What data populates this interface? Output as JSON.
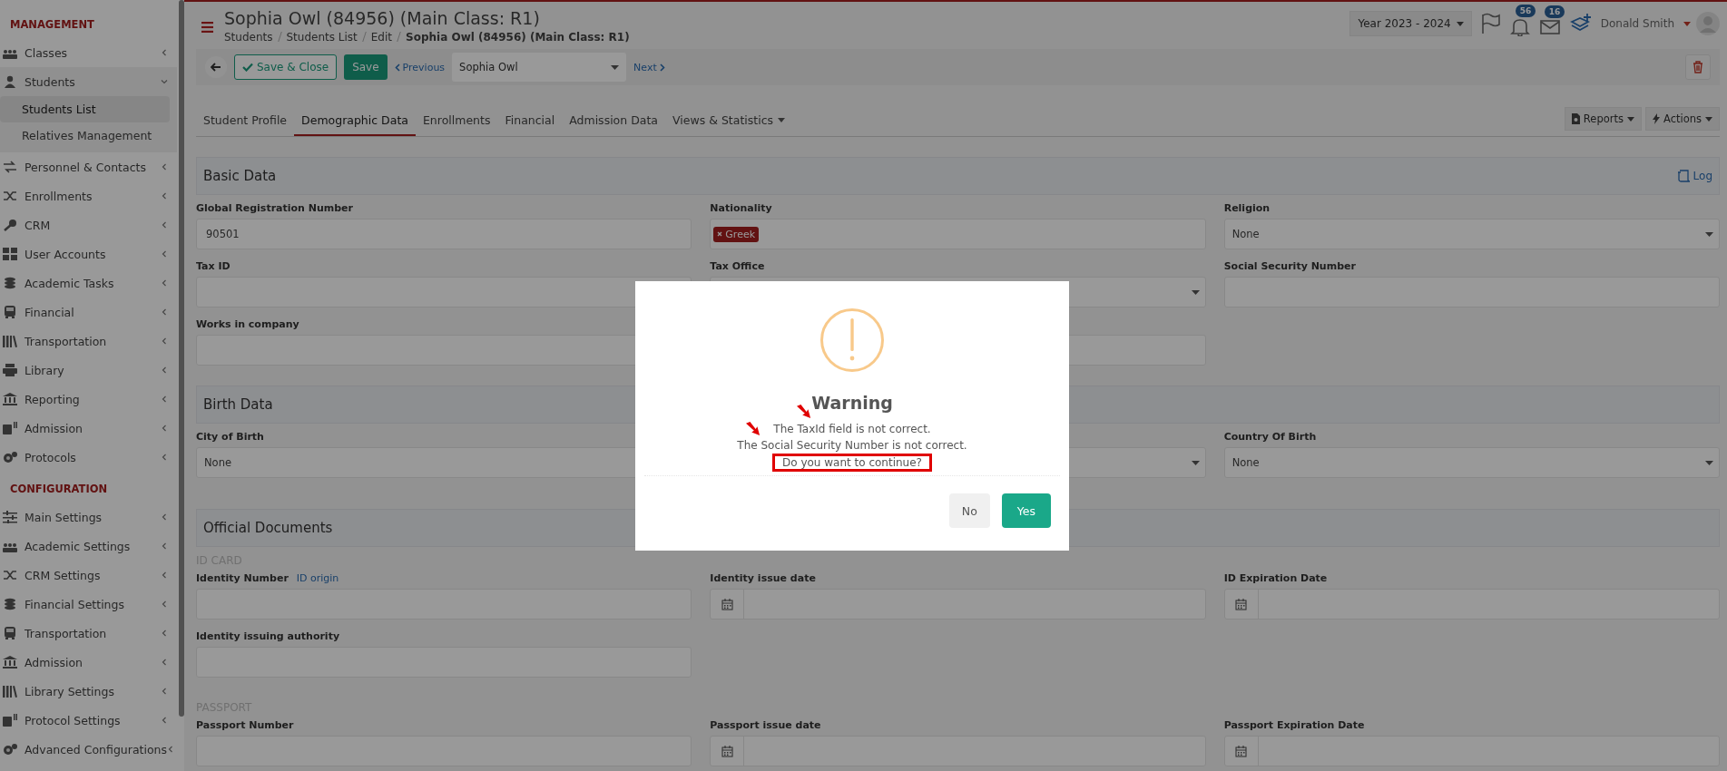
{
  "sidebar": {
    "sections": [
      {
        "heading": "MANAGEMENT",
        "items": [
          {
            "label": "Classes",
            "expanded": false
          },
          {
            "label": "Students",
            "expanded": true,
            "children": [
              {
                "label": "Students List",
                "selected": true
              },
              {
                "label": "Relatives Management",
                "selected": false
              }
            ]
          },
          {
            "label": "Personnel & Contacts",
            "expanded": false
          },
          {
            "label": "Enrollments",
            "expanded": false
          },
          {
            "label": "CRM",
            "expanded": false
          },
          {
            "label": "User Accounts",
            "expanded": false
          },
          {
            "label": "Academic Tasks",
            "expanded": false
          },
          {
            "label": "Financial",
            "expanded": false
          },
          {
            "label": "Transportation",
            "expanded": false
          },
          {
            "label": "Library",
            "expanded": false
          },
          {
            "label": "Reporting",
            "expanded": false
          },
          {
            "label": "Admission",
            "expanded": false
          },
          {
            "label": "Protocols",
            "expanded": false
          }
        ]
      },
      {
        "heading": "CONFIGURATION",
        "items": [
          {
            "label": "Main Settings",
            "expanded": false
          },
          {
            "label": "Academic Settings",
            "expanded": false
          },
          {
            "label": "CRM Settings",
            "expanded": false
          },
          {
            "label": "Financial Settings",
            "expanded": false
          },
          {
            "label": "Transportation",
            "expanded": false
          },
          {
            "label": "Admission",
            "expanded": false
          },
          {
            "label": "Library Settings",
            "expanded": false
          },
          {
            "label": "Protocol Settings",
            "expanded": false
          },
          {
            "label": "Advanced Configurations",
            "expanded": false
          }
        ]
      }
    ]
  },
  "header": {
    "title": "Sophia Owl (84956) (Main Class: R1)",
    "breadcrumb": [
      "Students",
      "Students List",
      "Edit",
      "Sophia Owl (84956) (Main Class: R1)"
    ],
    "year": "Year 2023 - 2024",
    "notifications": "56",
    "messages": "16",
    "user": "Donald Smith"
  },
  "toolbar": {
    "save_close": "Save & Close",
    "save": "Save",
    "previous": "Previous",
    "record": "Sophia Owl",
    "next": "Next"
  },
  "tabs": [
    {
      "label": "Student Profile",
      "selected": false,
      "dropdown": false
    },
    {
      "label": "Demographic Data",
      "selected": true,
      "dropdown": false
    },
    {
      "label": "Enrollments",
      "selected": false,
      "dropdown": false
    },
    {
      "label": "Financial",
      "selected": false,
      "dropdown": false
    },
    {
      "label": "Admission Data",
      "selected": false,
      "dropdown": false
    },
    {
      "label": "Views & Statistics",
      "selected": false,
      "dropdown": true
    }
  ],
  "tab_actions": [
    "Reports",
    "Actions"
  ],
  "sections": [
    {
      "title": "Basic Data",
      "log": "Log",
      "groups": [
        {
          "rows": [
            [
              {
                "label": "Global Registration Number",
                "kind": "text",
                "value": "90501"
              },
              {
                "label": "Nationality",
                "kind": "tags",
                "tags": [
                  "Greek"
                ]
              },
              {
                "label": "Religion",
                "kind": "select",
                "value": "None"
              }
            ],
            [
              {
                "label": "Tax ID",
                "kind": "text"
              },
              {
                "label": "Tax Office",
                "kind": "select"
              },
              {
                "label": "Social Security Number",
                "kind": "text"
              }
            ],
            [
              {
                "label": "Works in company",
                "kind": "text"
              },
              {
                "kind": "text"
              }
            ]
          ]
        }
      ]
    },
    {
      "title": "Birth Data",
      "groups": [
        {
          "rows": [
            [
              {
                "label": "City of Birth",
                "kind": "select",
                "value": "None"
              },
              {
                "kind": "select"
              },
              {
                "label": "Country Of Birth",
                "kind": "select",
                "value": "None"
              }
            ]
          ]
        }
      ]
    },
    {
      "title": "Official Documents",
      "groups": [
        {
          "heading": "ID CARD",
          "rows": [
            [
              {
                "label": "Identity Number",
                "link": "ID origin",
                "kind": "text"
              },
              {
                "label": "Identity issue date",
                "kind": "date"
              },
              {
                "label": "ID Expiration Date",
                "kind": "date"
              }
            ],
            [
              {
                "label": "Identity issuing authority",
                "kind": "text"
              }
            ]
          ]
        },
        {
          "heading": "PASSPORT",
          "rows": [
            [
              {
                "label": "Passport Number",
                "kind": "text"
              },
              {
                "label": "Passport issue date",
                "kind": "date"
              },
              {
                "label": "Passport Expiration Date",
                "kind": "date"
              }
            ]
          ]
        }
      ]
    }
  ],
  "dialog": {
    "title": "Warning",
    "messages": [
      "The TaxId field is not correct.",
      "The Social Security Number is not correct."
    ],
    "question": "Do you want to continue?",
    "question_highlighted": true,
    "buttons": [
      {
        "label": "No",
        "kind": "cancel"
      },
      {
        "label": "Yes",
        "kind": "confirm"
      }
    ]
  }
}
